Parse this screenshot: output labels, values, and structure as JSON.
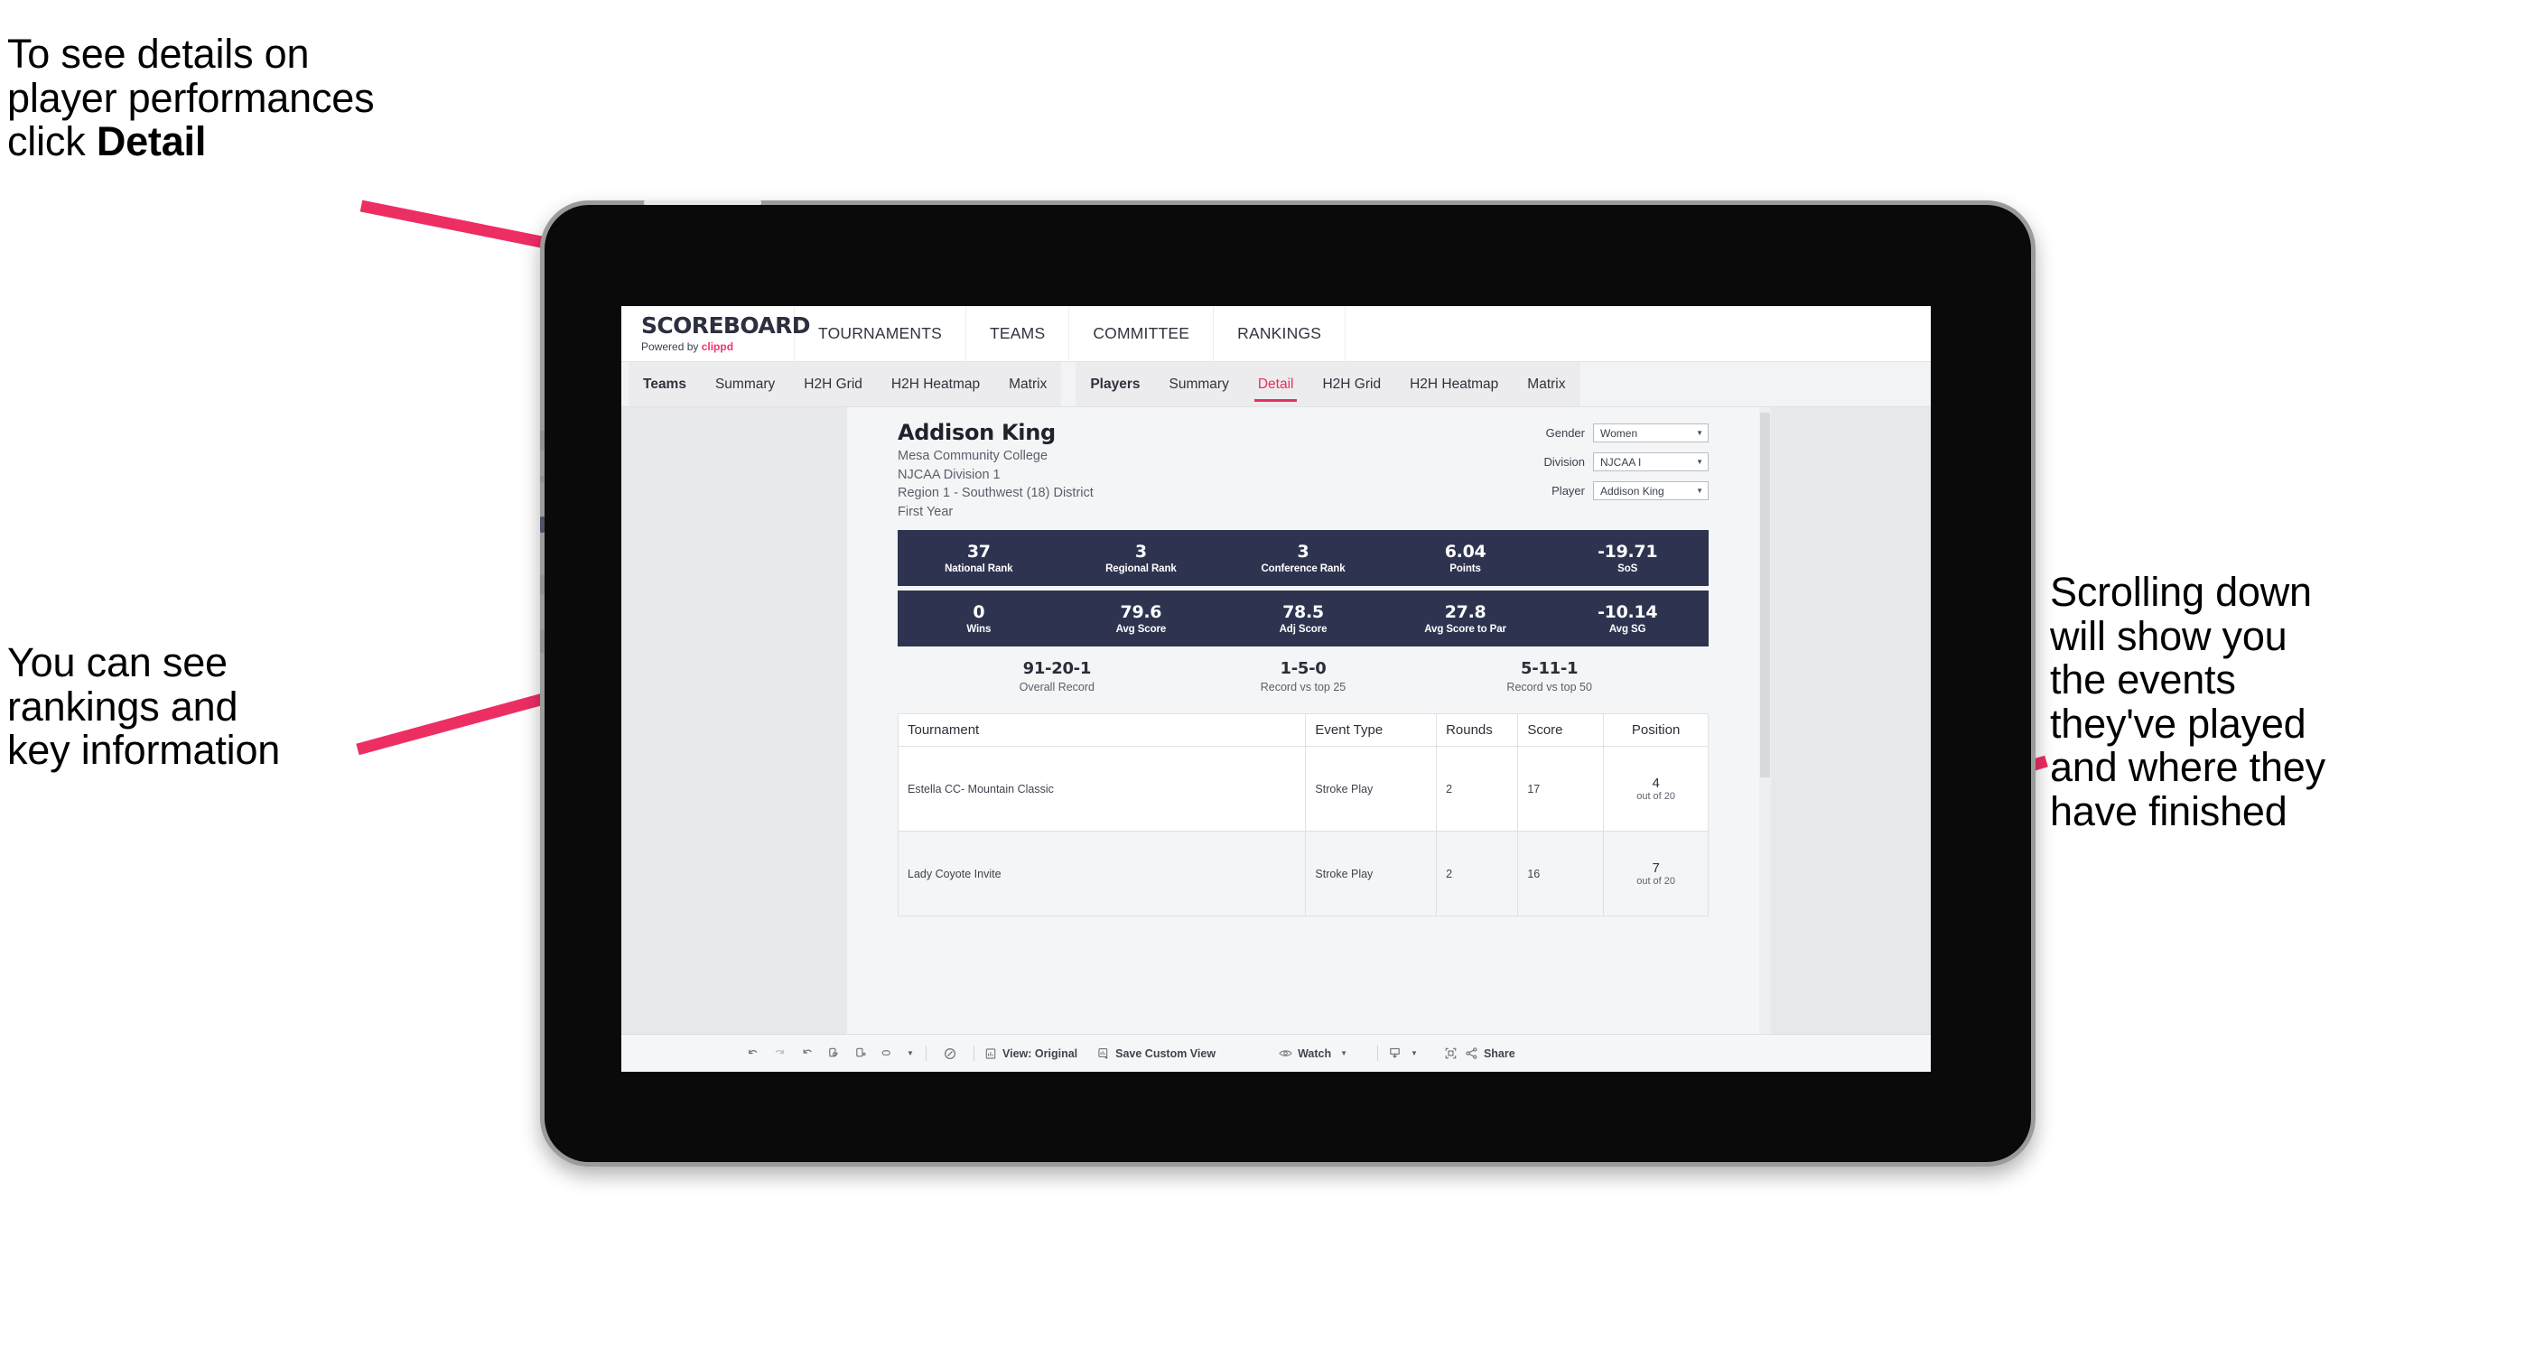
{
  "annotations": {
    "top_left": "To see details on\nplayer performances\nclick ",
    "top_left_bold": "Detail",
    "mid_left": "You can see\nrankings and\nkey information",
    "right": "Scrolling down\nwill show you\nthe events\nthey've played\nand where they\nhave finished",
    "accent_color": "#ED2E63"
  },
  "app": {
    "brand": {
      "title": "SCOREBOARD",
      "powered_prefix": "Powered by ",
      "powered_name": "clippd"
    },
    "top_nav": [
      "TOURNAMENTS",
      "TEAMS",
      "COMMITTEE",
      "RANKINGS"
    ],
    "sub_nav": {
      "teams_group": [
        "Teams",
        "Summary",
        "H2H Grid",
        "H2H Heatmap",
        "Matrix"
      ],
      "players_group": [
        "Players",
        "Summary",
        "Detail",
        "H2H Grid",
        "H2H Heatmap",
        "Matrix"
      ],
      "active_tab": "Detail"
    }
  },
  "player": {
    "name": "Addison King",
    "school": "Mesa Community College",
    "division": "NJCAA Division 1",
    "region": "Region 1 - Southwest (18) District",
    "year": "First Year"
  },
  "filters": [
    {
      "label": "Gender",
      "value": "Women"
    },
    {
      "label": "Division",
      "value": "NJCAA I"
    },
    {
      "label": "Player",
      "value": "Addison King"
    }
  ],
  "stats_row_1": [
    {
      "value": "37",
      "label": "National Rank"
    },
    {
      "value": "3",
      "label": "Regional Rank"
    },
    {
      "value": "3",
      "label": "Conference Rank"
    },
    {
      "value": "6.04",
      "label": "Points"
    },
    {
      "value": "-19.71",
      "label": "SoS"
    }
  ],
  "stats_row_2": [
    {
      "value": "0",
      "label": "Wins"
    },
    {
      "value": "79.6",
      "label": "Avg Score"
    },
    {
      "value": "78.5",
      "label": "Adj Score"
    },
    {
      "value": "27.8",
      "label": "Avg Score to Par"
    },
    {
      "value": "-10.14",
      "label": "Avg SG"
    }
  ],
  "records": [
    {
      "value": "91-20-1",
      "label": "Overall Record"
    },
    {
      "value": "1-5-0",
      "label": "Record vs top 25"
    },
    {
      "value": "5-11-1",
      "label": "Record vs top 50"
    }
  ],
  "events_table": {
    "headers": [
      "Tournament",
      "Event Type",
      "Rounds",
      "Score",
      "Position"
    ],
    "rows": [
      {
        "tournament": "Estella CC- Mountain Classic",
        "event_type": "Stroke Play",
        "rounds": "2",
        "score": "17",
        "position_num": "4",
        "position_out_of": "out of 20"
      },
      {
        "tournament": "Lady Coyote Invite",
        "event_type": "Stroke Play",
        "rounds": "2",
        "score": "16",
        "position_num": "7",
        "position_out_of": "out of 20"
      }
    ]
  },
  "bottom_toolbar": {
    "view_label": "View: Original",
    "save_label": "Save Custom View",
    "watch_label": "Watch",
    "share_label": "Share"
  }
}
